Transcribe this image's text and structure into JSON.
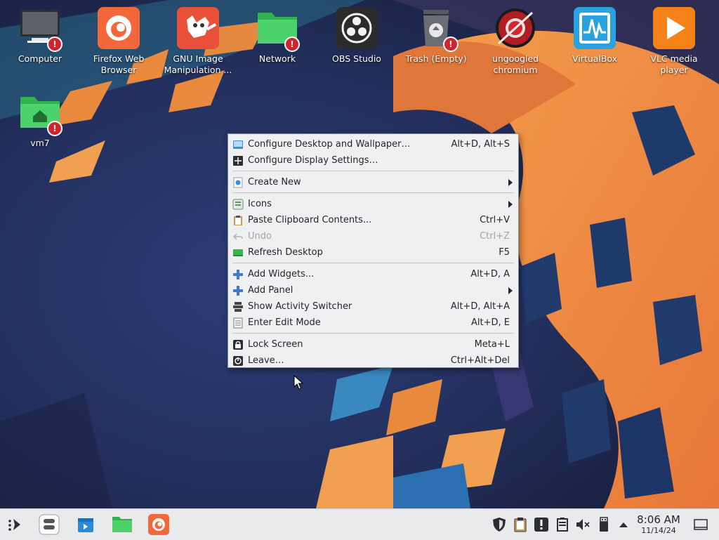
{
  "desktop": {
    "icons": [
      {
        "label": "Computer",
        "icon": "computer-icon",
        "badge": "!"
      },
      {
        "label": "Firefox Web Browser",
        "icon": "firefox-icon"
      },
      {
        "label": "GNU Image Manipulation ...",
        "icon": "gimp-icon"
      },
      {
        "label": "Network",
        "icon": "network-folder-icon",
        "badge": "!"
      },
      {
        "label": "OBS Studio",
        "icon": "obs-icon"
      },
      {
        "label": "Trash (Empty)",
        "icon": "trash-icon",
        "badge": "!"
      },
      {
        "label": "ungoogled chromium",
        "icon": "chromium-icon"
      },
      {
        "label": "VirtualBox",
        "icon": "virtualbox-icon"
      },
      {
        "label": "VLC media player",
        "icon": "vlc-icon"
      },
      {
        "label": "vm7",
        "icon": "home-folder-icon",
        "badge": "!"
      }
    ]
  },
  "context_menu": {
    "items": [
      {
        "label": "Configure Desktop and Wallpaper…",
        "shortcut": "Alt+D, Alt+S",
        "icon": "configure-desktop-icon"
      },
      {
        "label": "Configure Display Settings…",
        "shortcut": "",
        "icon": "display-settings-icon"
      },
      {
        "label": "Create New",
        "shortcut": "",
        "icon": "create-new-icon",
        "submenu": true
      },
      {
        "label": "Icons",
        "shortcut": "",
        "icon": "icons-icon",
        "submenu": true
      },
      {
        "label": "Paste Clipboard Contents...",
        "shortcut": "Ctrl+V",
        "icon": "paste-icon"
      },
      {
        "label": "Undo",
        "shortcut": "Ctrl+Z",
        "icon": "undo-icon",
        "disabled": true
      },
      {
        "label": "Refresh Desktop",
        "shortcut": "F5",
        "icon": "refresh-icon"
      },
      {
        "label": "Add Widgets...",
        "shortcut": "Alt+D, A",
        "icon": "add-widgets-icon"
      },
      {
        "label": "Add Panel",
        "shortcut": "",
        "icon": "add-panel-icon",
        "submenu": true
      },
      {
        "label": "Show Activity Switcher",
        "shortcut": "Alt+D, Alt+A",
        "icon": "activity-switcher-icon"
      },
      {
        "label": "Enter Edit Mode",
        "shortcut": "Alt+D, E",
        "icon": "edit-mode-icon"
      },
      {
        "label": "Lock Screen",
        "shortcut": "Meta+L",
        "icon": "lock-icon"
      },
      {
        "label": "Leave…",
        "shortcut": "Ctrl+Alt+Del",
        "icon": "leave-icon"
      }
    ]
  },
  "taskbar": {
    "launchers": [
      "app-launcher-icon",
      "pager-icon",
      "discover-icon",
      "file-manager-icon",
      "firefox-icon"
    ],
    "tray": [
      "security-shield-icon",
      "clipboard-icon",
      "notifications-icon",
      "battery-icon",
      "volume-muted-icon",
      "usb-device-icon",
      "tray-expand-icon"
    ],
    "clock": {
      "time": "8:06 AM",
      "date": "11/14/24"
    },
    "show_desktop_icon": "show-desktop-icon"
  },
  "colors": {
    "menu_bg": "#eff0f1",
    "taskbar_bg": "#e8eaec",
    "wallpaper_orange": "#f08a3c",
    "wallpaper_navy": "#1f2a4a",
    "badge_red": "#d2242d"
  }
}
